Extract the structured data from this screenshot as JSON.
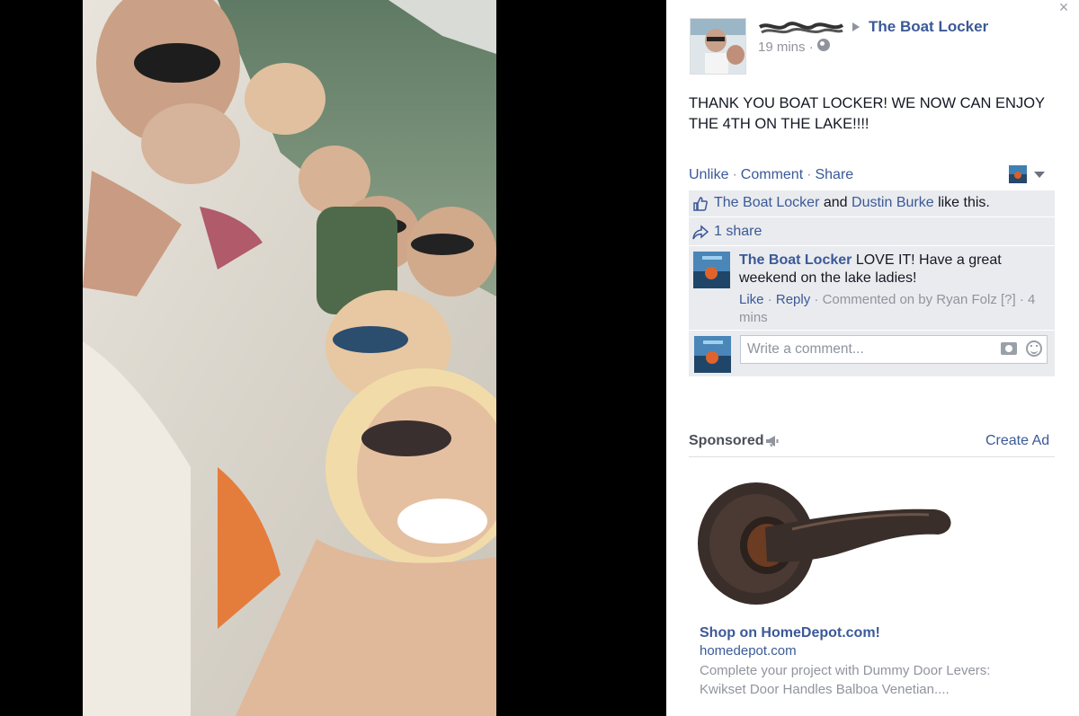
{
  "post": {
    "author_name": "",
    "target_page": "The Boat Locker",
    "timestamp": "19 mins ·",
    "text": "THANK YOU BOAT LOCKER! WE NOW CAN ENJOY THE 4TH ON THE LAKE!!!!",
    "privacy_icon": "globe-icon"
  },
  "actions": {
    "unlike": "Unlike",
    "comment": "Comment",
    "share": "Share",
    "separator": "·"
  },
  "likes": {
    "name1": "The Boat Locker",
    "and": "and",
    "name2": "Dustin Burke",
    "suffix": "like this."
  },
  "shares": {
    "label": "1 share"
  },
  "comment": {
    "author": "The Boat Locker",
    "text": "LOVE IT! Have a great weekend on the lake ladies!",
    "like": "Like",
    "reply": "Reply",
    "commented_by": "Commented on by Ryan Folz [?] ·",
    "time": "4 mins"
  },
  "composer": {
    "placeholder": "Write a comment..."
  },
  "sidebar": {
    "sponsored": "Sponsored",
    "create_ad": "Create Ad"
  },
  "ad": {
    "title": "Shop on HomeDepot.com!",
    "domain": "homedepot.com",
    "description": "Complete your project with Dummy Door Levers: Kwikset Door Handles Balboa Venetian...."
  },
  "colors": {
    "link": "#3b5998",
    "muted": "#90949c",
    "ufi_bg": "#e9ebee",
    "stage_bg": "#000000"
  },
  "close_icon": "×"
}
